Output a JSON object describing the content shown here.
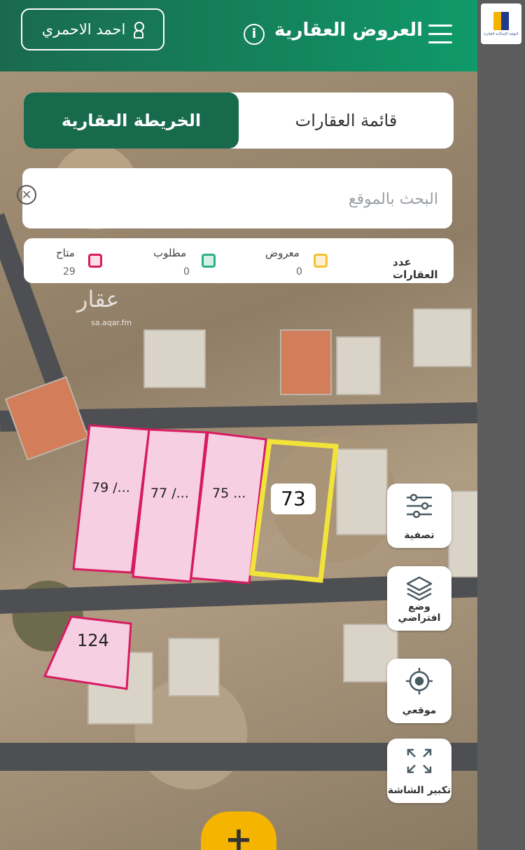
{
  "header": {
    "title": "العروض العقارية",
    "user_name": "احمد الاحمري"
  },
  "tabs": [
    {
      "label": "الخريطة العقارية",
      "active": true
    },
    {
      "label": "قائمة العقارات",
      "active": false
    }
  ],
  "search": {
    "placeholder": "البحث بالموقع",
    "value": ""
  },
  "legend": {
    "title": "عدد العقارات",
    "items": [
      {
        "label": "معروض",
        "count": "0",
        "color": "#f1c232"
      },
      {
        "label": "مطلوب",
        "count": "0",
        "color": "#2bb07f"
      },
      {
        "label": "متاح",
        "count": "29",
        "color": "#d81b60"
      }
    ]
  },
  "watermark": {
    "text": "عقار",
    "url": "sa.aqar.fm"
  },
  "plots": [
    {
      "label": "79 /...",
      "status": "متاح"
    },
    {
      "label": "77 /...",
      "status": "متاح"
    },
    {
      "label": "75 ...",
      "status": "متاح"
    },
    {
      "label": "73",
      "status": "معروض"
    },
    {
      "label": "124",
      "status": "متاح"
    }
  ],
  "map_buttons": [
    {
      "label": "تصفية",
      "icon": "filter-sliders-icon"
    },
    {
      "label": "وضع افتراضي",
      "icon": "layers-icon"
    },
    {
      "label": "موقعي",
      "icon": "my-location-icon"
    },
    {
      "label": "تكبير الشاشة",
      "icon": "fullscreen-icon"
    }
  ],
  "add_button": {
    "label": "+"
  },
  "brand": {
    "caption": "النهضة الإسكانية العقارية"
  },
  "colors": {
    "primary": "#186a4d",
    "accent": "#f5b400"
  }
}
